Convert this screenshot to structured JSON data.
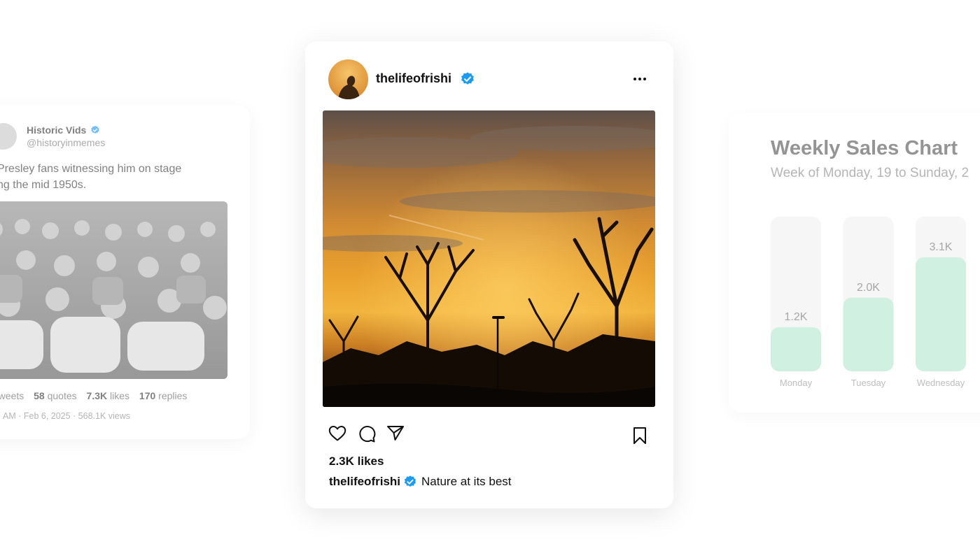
{
  "tweet": {
    "name": "Historic Vids",
    "handle": "@historyinmemes",
    "text_line1": "Presley fans witnessing him on stage",
    "text_line2": "ng the mid 1950s.",
    "retweets_label": "etweets",
    "quotes_value": "58",
    "quotes_label": "quotes",
    "likes_value": "7.3K",
    "likes_label": "likes",
    "replies_value": "170",
    "replies_label": "replies",
    "meta": "AM · Feb 6, 2025 · 568.1K views"
  },
  "post": {
    "username": "thelifeofrishi",
    "likes": "2.3K likes",
    "caption_user": "thelifeofrishi",
    "caption_text": "Nature at its best",
    "icons": [
      "heart-icon",
      "comment-icon",
      "share-icon",
      "bookmark-icon",
      "more-icon",
      "verified-icon"
    ]
  },
  "chart_data": {
    "type": "bar",
    "title": "Weekly Sales Chart",
    "subtitle": "Week of Monday, 19 to Sunday, 2",
    "categories": [
      "Monday",
      "Tuesday",
      "Wednesday"
    ],
    "values": [
      1.2,
      2.0,
      3.1
    ],
    "value_labels": [
      "1.2K",
      "2.0K",
      "3.1K"
    ],
    "ylim": [
      0,
      4.2
    ],
    "bar_color": "#9ee2c4",
    "track_color": "#eeeeee"
  },
  "colors": {
    "verified": "#1d9bf0",
    "text": "#111111"
  }
}
